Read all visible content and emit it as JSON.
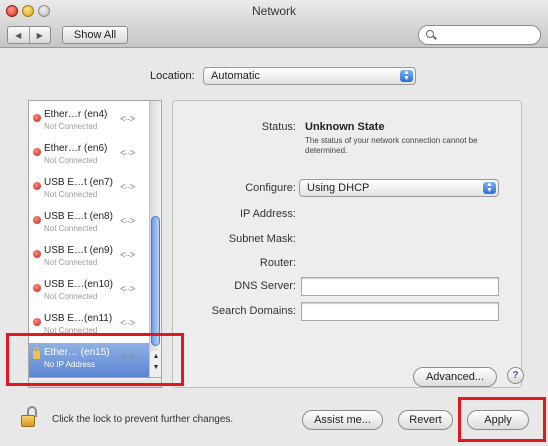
{
  "window": {
    "title": "Network"
  },
  "toolbar": {
    "back_glyph": "◀",
    "forward_glyph": "▶",
    "show_all_label": "Show All",
    "search_value": ""
  },
  "location": {
    "label": "Location:",
    "value": "Automatic"
  },
  "services": [
    {
      "name": "Ether…r (en4)",
      "status": "Not Connected"
    },
    {
      "name": "Ether…r (en6)",
      "status": "Not Connected"
    },
    {
      "name": "USB E…t (en7)",
      "status": "Not Connected"
    },
    {
      "name": "USB E…t (en8)",
      "status": "Not Connected"
    },
    {
      "name": "USB E…t (en9)",
      "status": "Not Connected"
    },
    {
      "name": "USB E…(en10)",
      "status": "Not Connected"
    },
    {
      "name": "USB E…(en11)",
      "status": "Not Connected"
    },
    {
      "name": "Ether… (en15)",
      "status": "No IP Address",
      "selected": true
    }
  ],
  "list_controls": {
    "add": "+",
    "remove": "−"
  },
  "detail": {
    "status_label": "Status:",
    "status_value": "Unknown State",
    "status_desc": "The status of your network connection cannot be determined.",
    "configure_label": "Configure:",
    "configure_value": "Using DHCP",
    "ip_label": "IP Address:",
    "subnet_label": "Subnet Mask:",
    "router_label": "Router:",
    "dns_label": "DNS Server:",
    "dns_value": "",
    "search_domains_label": "Search Domains:",
    "search_domains_value": "",
    "advanced_label": "Advanced...",
    "help_label": "?"
  },
  "footer": {
    "lock_text": "Click the lock to prevent further changes.",
    "assist_label": "Assist me...",
    "revert_label": "Revert",
    "apply_label": "Apply"
  },
  "colors": {
    "highlight": "#e1191e",
    "selection": "#5a86d2",
    "status_dot": "#c42114"
  }
}
